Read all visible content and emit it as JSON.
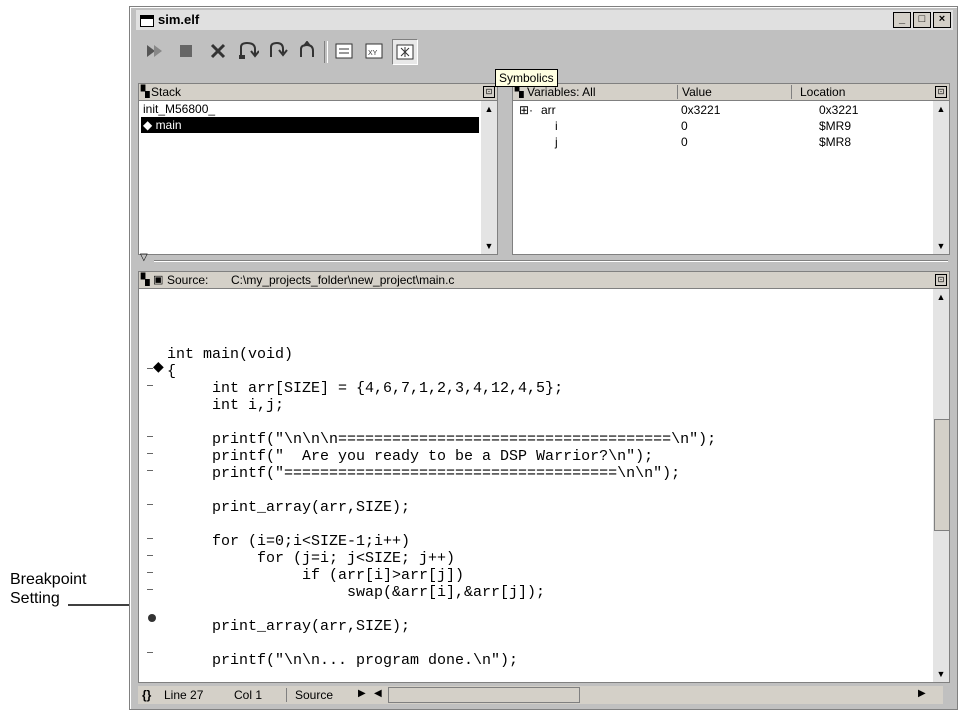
{
  "annotation": {
    "line1": "Breakpoint",
    "line2": "Setting"
  },
  "window": {
    "title": "sim.elf",
    "minimize": "_",
    "maximize": "□",
    "close": "×"
  },
  "toolbar": {
    "tools": [
      "run-icon",
      "stop-icon",
      "kill-icon",
      "step-over-icon",
      "step-into-icon",
      "step-out-icon",
      "view-register-icon",
      "view-xy-icon",
      "symbolics-icon"
    ],
    "xy_label": "XY"
  },
  "tooltip": "Symbolics",
  "stack": {
    "header": "Stack",
    "items": [
      "init_M56800_",
      "main"
    ],
    "selected": "main"
  },
  "variables": {
    "columns": [
      "Variables: All",
      "Value",
      "Location"
    ],
    "rows": [
      {
        "name": "arr",
        "value": "0x3221",
        "location": "0x3221",
        "expand": "⊞·"
      },
      {
        "name": "i",
        "value": "0",
        "location": "$MR9"
      },
      {
        "name": "j",
        "value": "0",
        "location": "$MR8"
      }
    ]
  },
  "source": {
    "label": "Source:",
    "path": "C:\\my_projects_folder\\new_project\\main.c",
    "lines": [
      "int main(void)",
      "{",
      "     int arr[SIZE] = {4,6,7,1,2,3,4,12,4,5};",
      "     int i,j;",
      "",
      "     printf(\"\\n\\n\\n=====================================\\n\");",
      "     printf(\"  Are you ready to be a DSP Warrior?\\n\");",
      "     printf(\"=====================================\\n\\n\");",
      "",
      "     print_array(arr,SIZE);",
      "",
      "     for (i=0;i<SIZE-1;i++)",
      "          for (j=i; j<SIZE; j++)",
      "               if (arr[i]>arr[j])",
      "                    swap(&arr[i],&arr[j]);",
      "",
      "     print_array(arr,SIZE);",
      "",
      "     printf(\"\\n\\n... program done.\\n\");"
    ]
  },
  "status": {
    "braces": "{}",
    "line": "Line 27",
    "col": "Col 1",
    "mode": "Source"
  }
}
